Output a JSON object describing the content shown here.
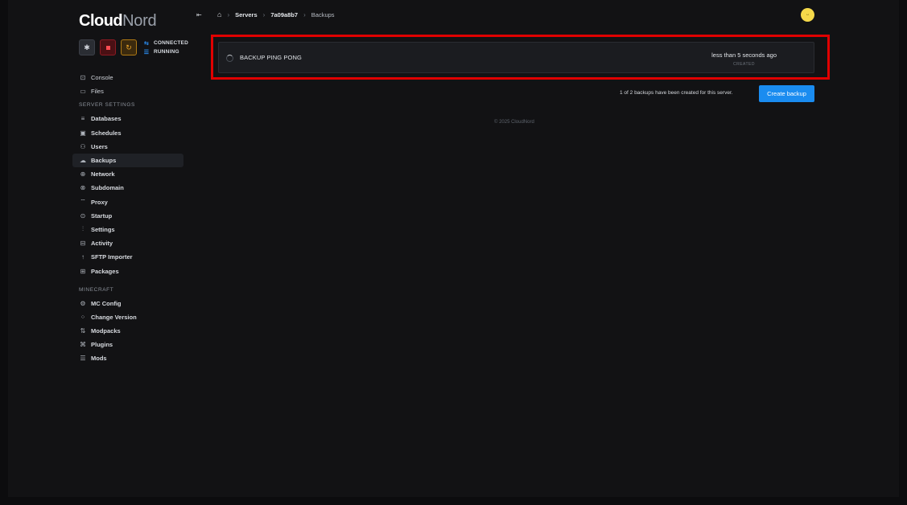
{
  "brand": {
    "name_bold": "Cloud",
    "name_light": "Nord"
  },
  "controls": {
    "status_connected": "CONNECTED",
    "status_running": "RUNNING"
  },
  "nav": {
    "console": "Console",
    "files": "Files",
    "server_settings_title": "SERVER SETTINGS",
    "databases": "Databases",
    "schedules": "Schedules",
    "users": "Users",
    "backups": "Backups",
    "network": "Network",
    "subdomain": "Subdomain",
    "proxy": "Proxy",
    "startup": "Startup",
    "settings": "Settings",
    "activity": "Activity",
    "sftp_importer": "SFTP Importer",
    "packages": "Packages",
    "minecraft_title": "MINECRAFT",
    "mc_config": "MC Config",
    "change_version": "Change Version",
    "modpacks": "Modpacks",
    "plugins": "Plugins",
    "mods": "Mods"
  },
  "breadcrumb": {
    "servers": "Servers",
    "server_id": "7a09a8b7",
    "current": "Backups"
  },
  "backup": {
    "name": "BACKUP PING PONG",
    "time": "less than 5 seconds ago",
    "time_label": "CREATED"
  },
  "backup_count_text": "1 of 2 backups have been created for this server.",
  "create_button": "Create backup",
  "footer": "© 2025 CloudNord",
  "colors": {
    "accent": "#1a8cf0",
    "highlight": "#e00000",
    "stop": "#ff4b52",
    "restart": "#f0a82a"
  }
}
